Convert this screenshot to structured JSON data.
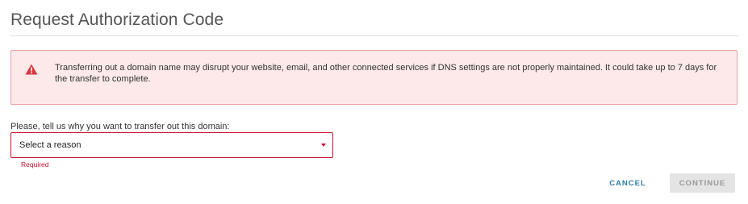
{
  "page": {
    "title": "Request Authorization Code"
  },
  "alert": {
    "icon": "warning-icon",
    "message": "Transferring out a domain name may disrupt your website, email, and other connected services if DNS settings are not properly maintained. It could take up to 7 days for the transfer to complete."
  },
  "form": {
    "reason_label": "Please, tell us why you want to transfer out this domain:",
    "reason_select": {
      "selected": "Select a reason"
    },
    "error": "Required"
  },
  "actions": {
    "cancel_label": "CANCEL",
    "continue_label": "CONTINUE"
  },
  "colors": {
    "accent_error": "#c8102e",
    "alert_background": "#fde9e9",
    "alert_border": "#e9a3a8",
    "link_blue": "#2f7ea8",
    "disabled_button": "#e4e4e4"
  }
}
